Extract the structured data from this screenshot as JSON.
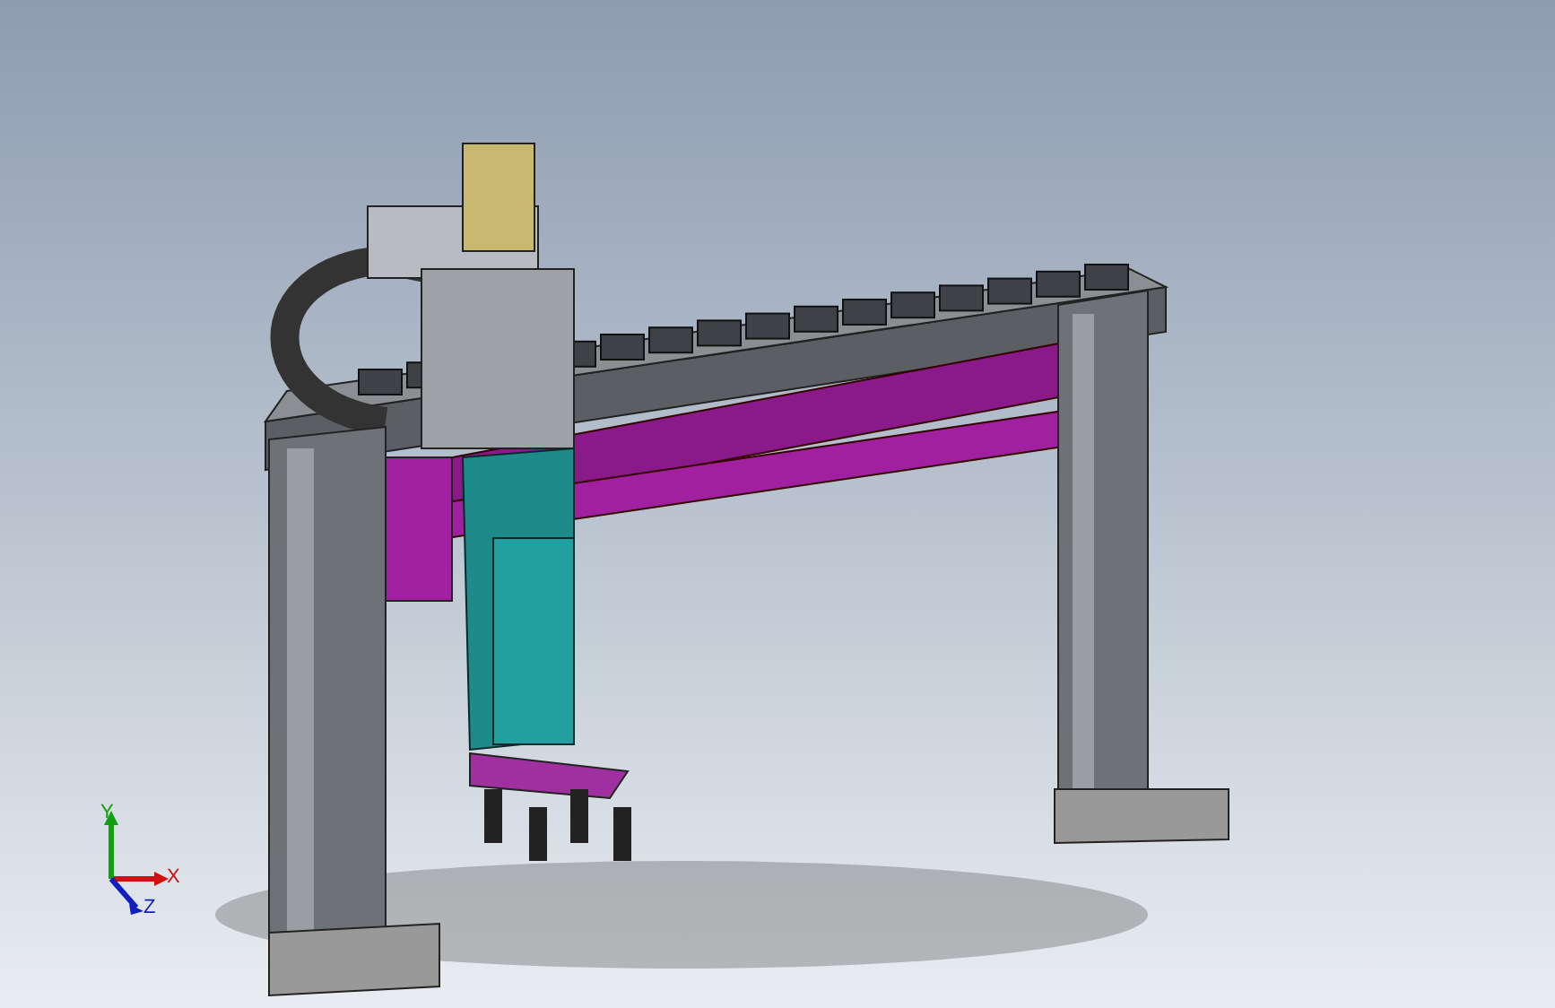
{
  "viewport": {
    "triad": {
      "axes": [
        {
          "label": "X",
          "color": "#d01010"
        },
        {
          "label": "Y",
          "color": "#10a010"
        },
        {
          "label": "Z",
          "color": "#1020c0"
        }
      ]
    }
  }
}
